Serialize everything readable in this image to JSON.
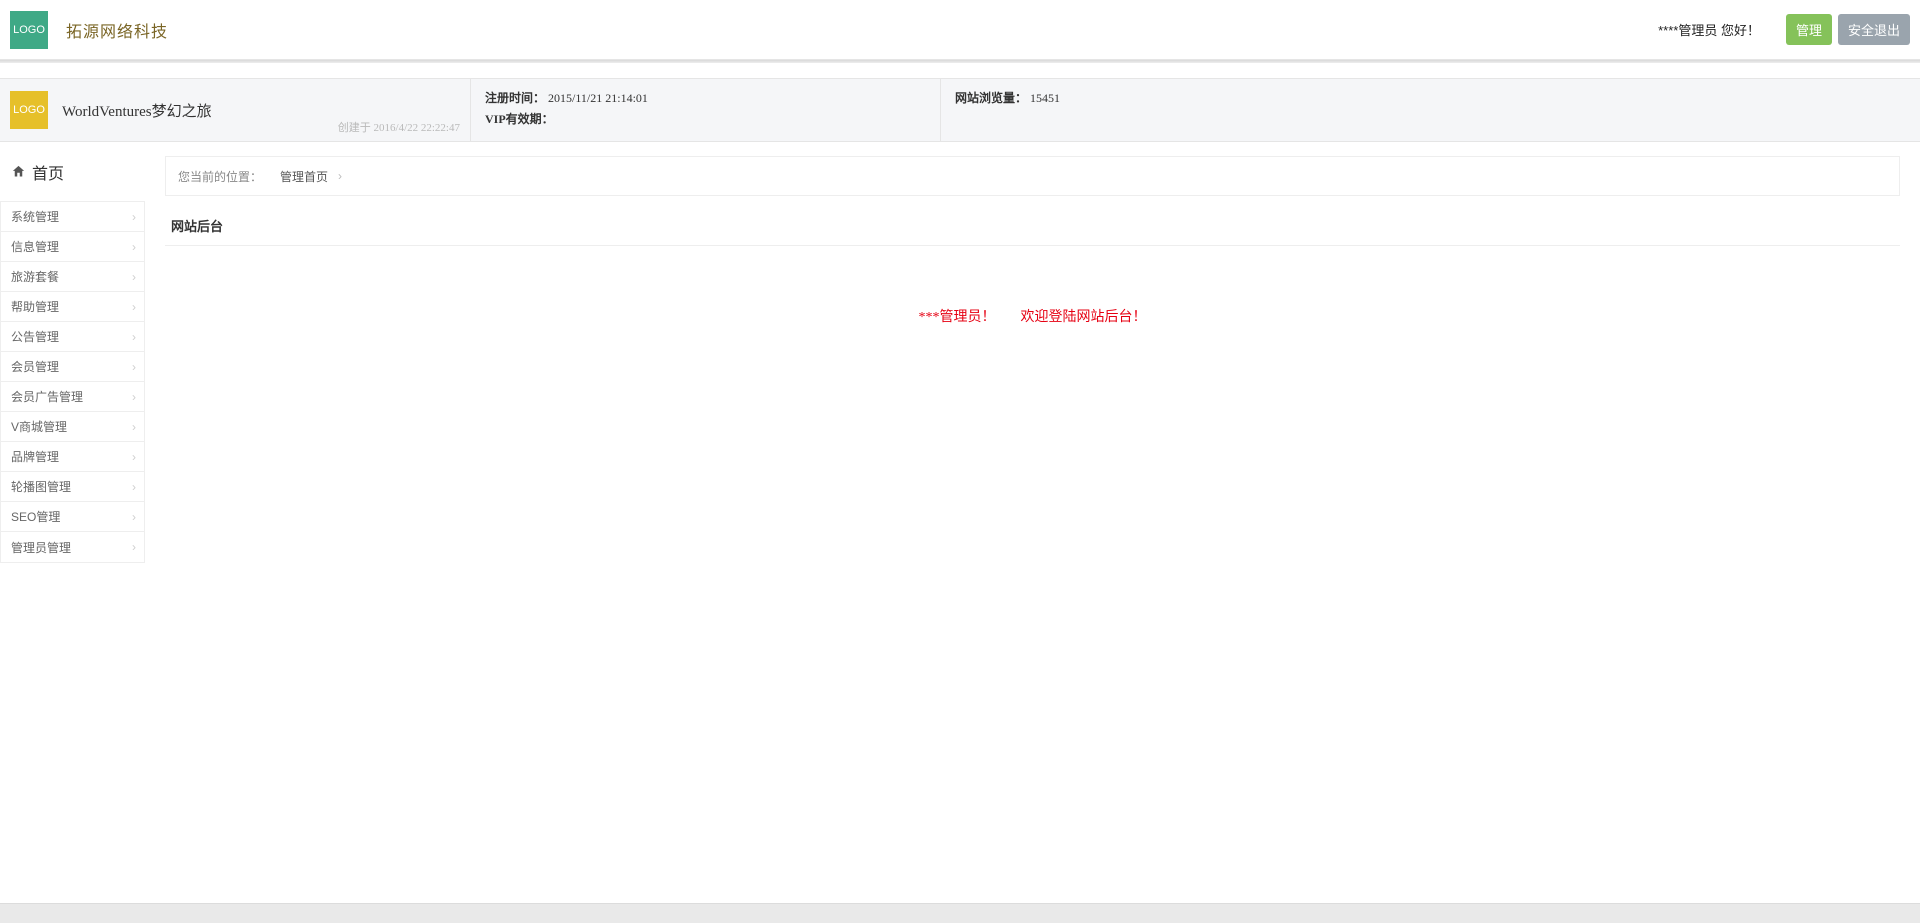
{
  "header": {
    "logo_text": "LOGO",
    "company": "拓源网络科技",
    "greeting": "****管理员 您好！",
    "btn_manage": "管理",
    "btn_logout": "安全退出"
  },
  "subheader": {
    "logo_text": "LOGO",
    "site_name": "WorldVentures梦幻之旅",
    "created_label": "创建于",
    "created_time": "2016/4/22 22:22:47",
    "register_label": "注册时间：",
    "register_time": "2015/11/21 21:14:01",
    "vip_label": "VIP有效期：",
    "vip_value": "",
    "views_label": "网站浏览量：",
    "views_value": "15451"
  },
  "sidebar": {
    "home": "首页",
    "items": [
      {
        "label": "系统管理"
      },
      {
        "label": "信息管理"
      },
      {
        "label": "旅游套餐"
      },
      {
        "label": "帮助管理"
      },
      {
        "label": "公告管理"
      },
      {
        "label": "会员管理"
      },
      {
        "label": "会员广告管理"
      },
      {
        "label": "V商城管理"
      },
      {
        "label": "品牌管理"
      },
      {
        "label": "轮播图管理"
      },
      {
        "label": "SEO管理"
      },
      {
        "label": "管理员管理"
      }
    ]
  },
  "breadcrumb": {
    "location_label": "您当前的位置：",
    "home_link": "管理首页"
  },
  "panel": {
    "title": "网站后台"
  },
  "welcome": {
    "part1": "***管理员！",
    "part2": "欢迎登陆网站后台！"
  }
}
